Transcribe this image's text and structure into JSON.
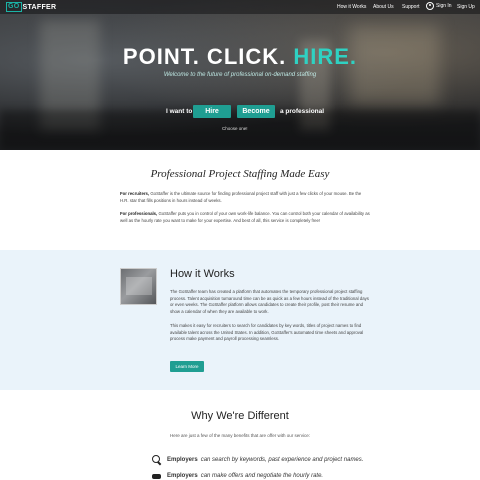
{
  "nav": {
    "logo_go": "GO",
    "logo_staffer": "STAFFER",
    "links": [
      "How it Works",
      "About Us",
      "Support"
    ],
    "sign_in": "Sign In",
    "sign_up": "Sign Up"
  },
  "hero": {
    "title_a": "POINT. CLICK. ",
    "title_b": "HIRE.",
    "subtitle": "Welcome to the future of professional on-demand staffing",
    "i_want_to": "I want to",
    "hire_btn": "Hire",
    "become_btn": "Become",
    "a_professional": "a professional",
    "choose_one": "Choose one!"
  },
  "section1": {
    "title": "Professional Project Staffing Made Easy",
    "p1_lead": "For recruiters,",
    "p1_text": " GoStaffer is the ultimate source for finding professional project staff with just a few clicks of your mouse. Be the H.R. star that fills positions in hours instead of weeks.",
    "p2_lead": "For professionals,",
    "p2_text": " GoStaffer puts you in control of your own work-life balance. You can control both your calendar of availability as well as the hourly rate you want to make for your expertise. And best of all, this service is completely free!"
  },
  "section2": {
    "title": "How it Works",
    "p1": "The GoStaffer team has created a platform that automates the temporary professional project staffing process. Talent acquisition turnaround time can be as quick as a few hours instead of the traditional days or even weeks. The GoStaffer platform allows candidates to create their profile, post their resume and show a calendar of when they are available to work.",
    "p2": "This makes it easy for recruiters to search for candidates by key words, titles of project names to find available talent across the United States. In addition, GoStaffer's automated time sheets and approval process make payment and payroll processing seamless.",
    "button": "Learn More"
  },
  "section3": {
    "title": "Why We're Different",
    "subtitle": "Here are just a few of the many benefits that are offer with our service:",
    "items": [
      {
        "lead": "Employers",
        "text": "can search by keywords, past experience and project names.",
        "icon": "search-icon"
      },
      {
        "lead": "Employers",
        "text": "can make offers and negotiate the hourly rate.",
        "icon": "handshake-icon"
      }
    ]
  },
  "colors": {
    "accent": "#1f9e92",
    "accent_light": "#2fd1c2",
    "section_bg": "#eaf3fa"
  }
}
